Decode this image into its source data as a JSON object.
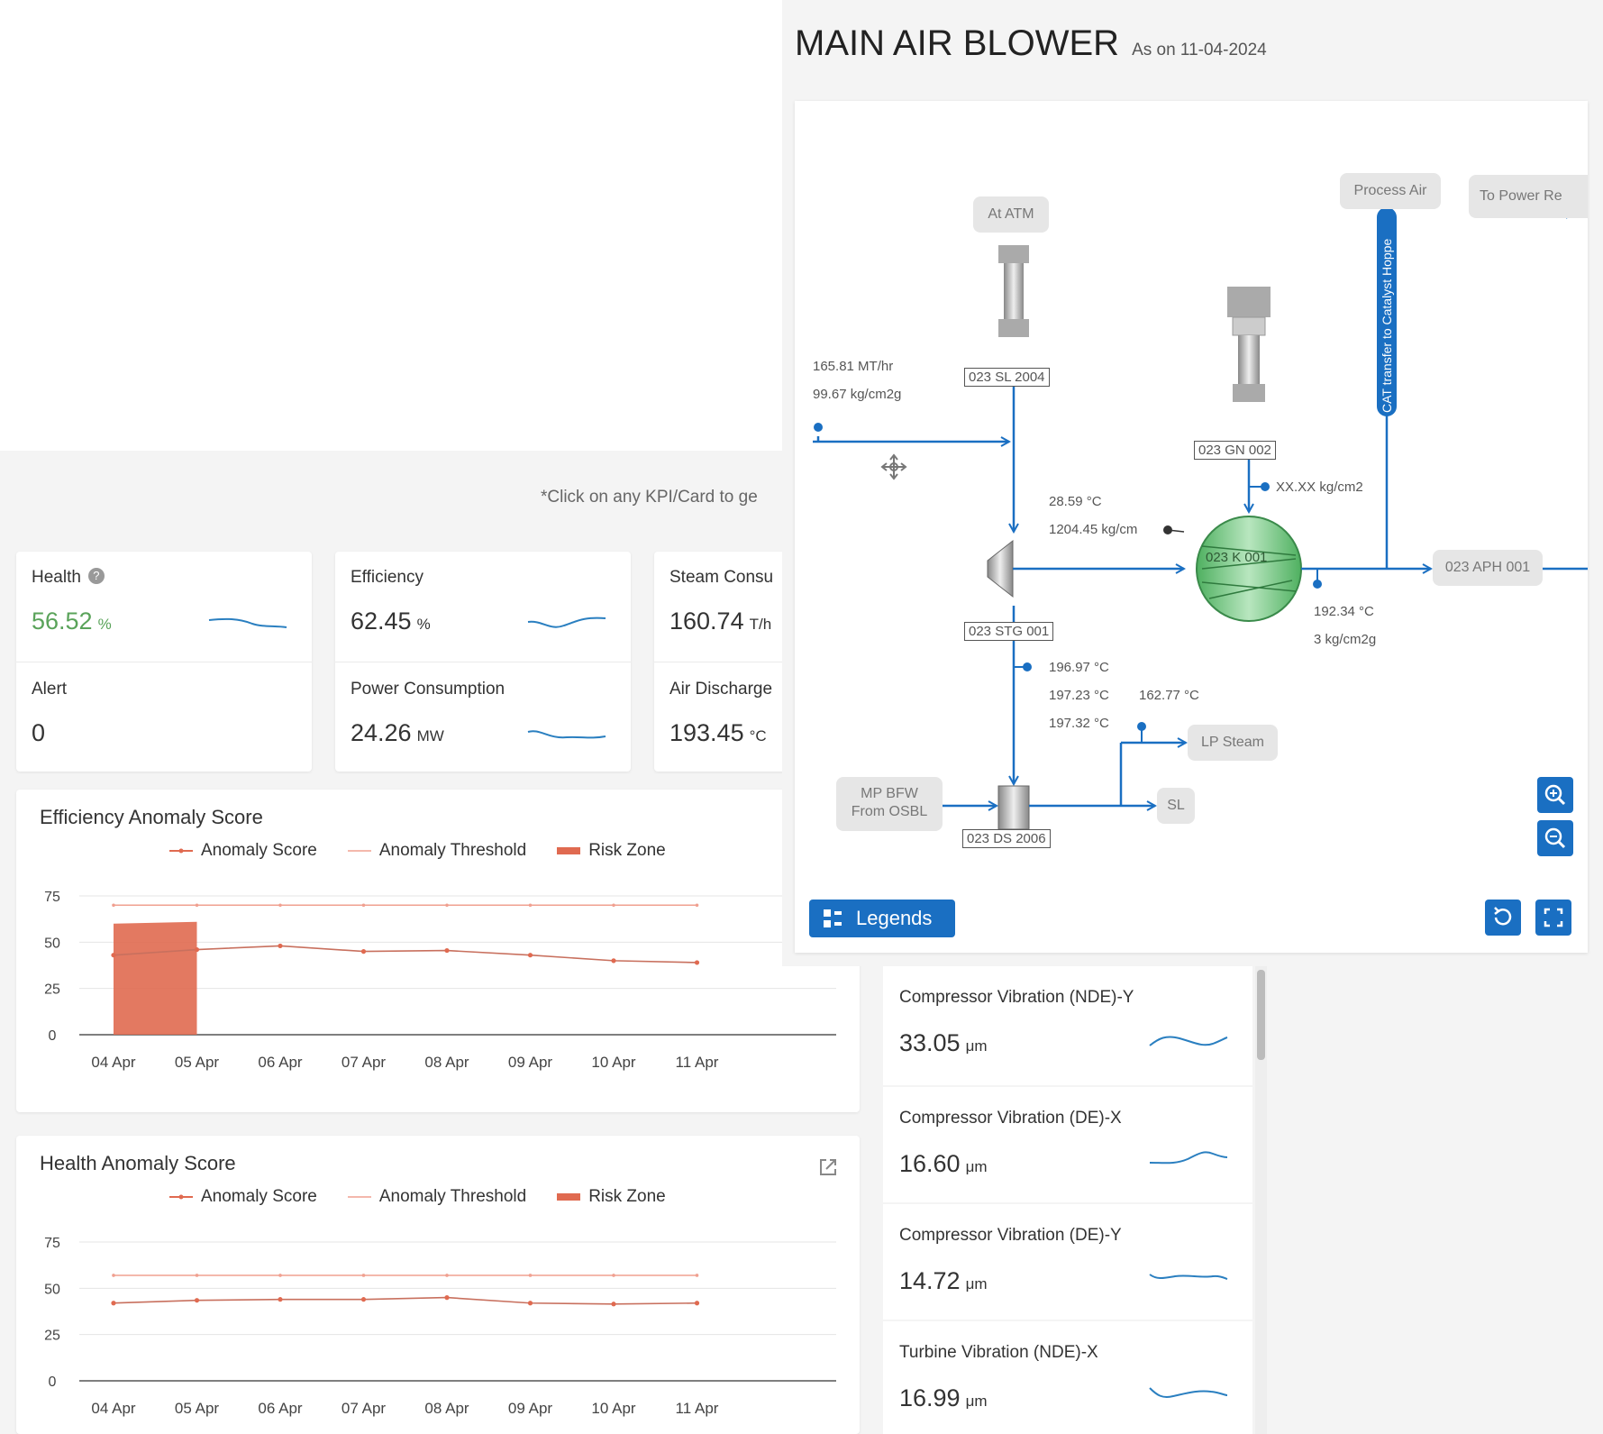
{
  "hint": "*Click on any KPI/Card to ge",
  "colors": {
    "accent": "#1a6fc2",
    "health_green": "#5aa35a",
    "anomaly_red": "#e06a50",
    "spark_blue": "#2a7fc0",
    "compressor_green": "#6cc27a"
  },
  "kpis": [
    {
      "title": "Health",
      "value": "56.52",
      "unit": "%",
      "help": "?"
    },
    {
      "title": "Alert",
      "value": "0"
    },
    {
      "title": "Efficiency",
      "value": "62.45",
      "unit": "%"
    },
    {
      "title": "Power Consumption",
      "value": "24.26",
      "unit": "MW"
    },
    {
      "title": "Steam Consu",
      "value": "160.74",
      "unit": "T/h"
    },
    {
      "title": "Air Discharge",
      "value": "193.45",
      "unit": "°C"
    }
  ],
  "charts": {
    "efficiency_title": "Efficiency Anomaly Score",
    "health_title": "Health Anomaly Score",
    "legend": {
      "score": "Anomaly Score",
      "threshold": "Anomaly Threshold",
      "risk": "Risk Zone"
    }
  },
  "chart_data": [
    {
      "type": "line",
      "title": "Efficiency Anomaly Score",
      "x": [
        "04 Apr",
        "05 Apr",
        "06 Apr",
        "07 Apr",
        "08 Apr",
        "09 Apr",
        "10 Apr",
        "11 Apr"
      ],
      "ylim": [
        0,
        75
      ],
      "yticks": [
        "0",
        "25",
        "50",
        "75"
      ],
      "series": [
        {
          "name": "Anomaly Score",
          "values": [
            43,
            46,
            48,
            45,
            45.5,
            43,
            40,
            39
          ]
        },
        {
          "name": "Anomaly Threshold",
          "values": [
            70,
            70,
            70,
            70,
            70,
            70,
            70,
            70
          ]
        }
      ],
      "risk_zone": {
        "name": "Risk Zone",
        "x_from": "04 Apr",
        "x_to": "05 Apr",
        "values": [
          60,
          61
        ]
      },
      "grid": true,
      "legend_position": "top"
    },
    {
      "type": "line",
      "title": "Health Anomaly Score",
      "x": [
        "04 Apr",
        "05 Apr",
        "06 Apr",
        "07 Apr",
        "08 Apr",
        "09 Apr",
        "10 Apr",
        "11 Apr"
      ],
      "ylim": [
        0,
        75
      ],
      "yticks": [
        "0",
        "25",
        "50",
        "75"
      ],
      "series": [
        {
          "name": "Anomaly Score",
          "values": [
            42,
            43.5,
            44,
            44,
            45,
            42,
            41.5,
            42
          ]
        },
        {
          "name": "Anomaly Threshold",
          "values": [
            57,
            57,
            57,
            57,
            57,
            57,
            57,
            57
          ]
        }
      ],
      "grid": true,
      "legend_position": "top"
    }
  ],
  "vibration": [
    {
      "title": "Compressor Vibration (NDE)-Y",
      "value": "33.05",
      "unit": "μm"
    },
    {
      "title": "Compressor Vibration (DE)-X",
      "value": "16.60",
      "unit": "μm"
    },
    {
      "title": "Compressor Vibration (DE)-Y",
      "value": "14.72",
      "unit": "μm"
    },
    {
      "title": "Turbine Vibration (NDE)-X",
      "value": "16.99",
      "unit": "μm"
    }
  ],
  "mab": {
    "title": "MAIN AIR BLOWER",
    "subtitle": "As on 11-04-2024",
    "legends_label": "Legends",
    "diagram": {
      "tags": {
        "sl2004": "023 SL 2004",
        "gn002": "023 GN 002",
        "stg001": "023 STG 001",
        "ds2006": "023 DS 2006",
        "k001": "023 K 001"
      },
      "pills": {
        "atm": "At ATM",
        "process_air": "Process Air",
        "power_re": "To Power Re",
        "aph": "023 APH 001",
        "lp_steam": "LP Steam",
        "sl": "SL",
        "mpbfw_1": "MP BFW",
        "mpbfw_2": "From OSBL"
      },
      "vertical_label": "CAT transfer to Catalyst Hoppe",
      "labels": {
        "flow": "165.81 MT/hr",
        "press_in": "99.67 kg/cm2g",
        "gn_press": "XX.XX kg/cm2",
        "k_temp": "28.59 °C",
        "k_press": "1204.45 kg/cm",
        "out_temp": "192.34 °C",
        "out_press": "3 kg/cm2g",
        "t1": "196.97 °C",
        "t2": "197.23 °C",
        "t3": "197.32 °C",
        "t4": "162.77 °C"
      }
    }
  }
}
